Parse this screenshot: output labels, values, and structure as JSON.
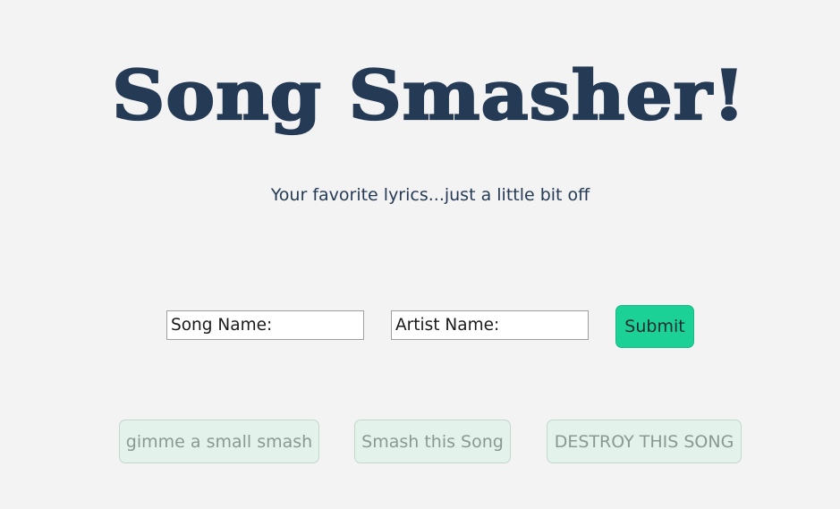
{
  "header": {
    "title": "Song Smasher!",
    "subtitle": "Your favorite lyrics...just a little bit off"
  },
  "form": {
    "song_placeholder": "Song Name:",
    "artist_placeholder": "Artist Name:",
    "submit_label": "Submit"
  },
  "smash_options": {
    "small_label": "gimme a small smash",
    "medium_label": "Smash this Song",
    "destroy_label": "DESTROY THIS SONG"
  },
  "colors": {
    "background": "#f3f3f3",
    "title": "#253b55",
    "submit": "#1cd196",
    "smash_buttons_disabled": "#e3f2ea"
  }
}
